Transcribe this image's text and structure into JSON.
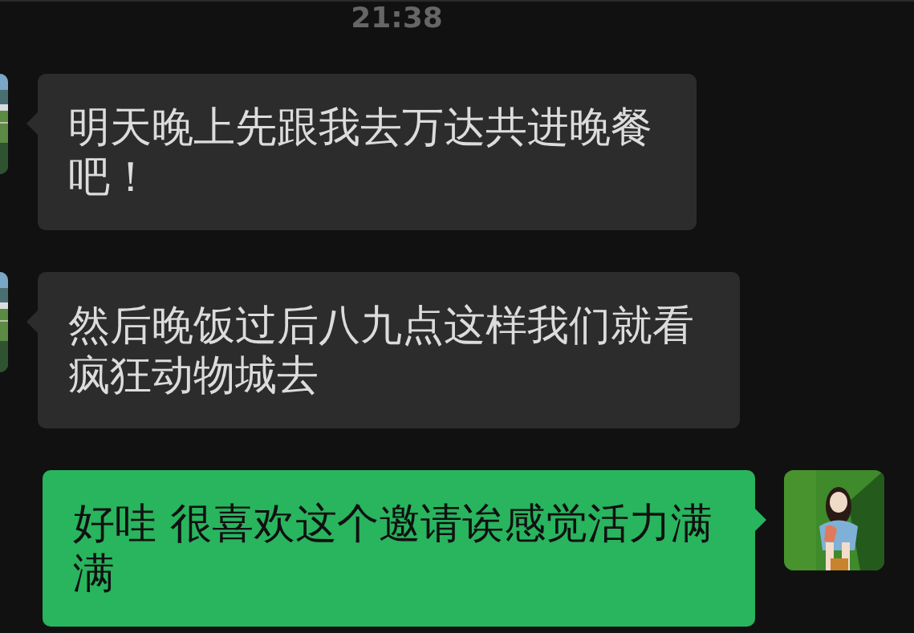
{
  "timestamp": "21:38",
  "messages": [
    {
      "kind": "received",
      "text": "明天晚上先跟我去万达共进晚餐吧！"
    },
    {
      "kind": "received",
      "text": "然后晚饭过后八九点这样我们就看疯狂动物城去"
    },
    {
      "kind": "sent",
      "text": "好哇 很喜欢这个邀请诶感觉活力满满"
    }
  ]
}
